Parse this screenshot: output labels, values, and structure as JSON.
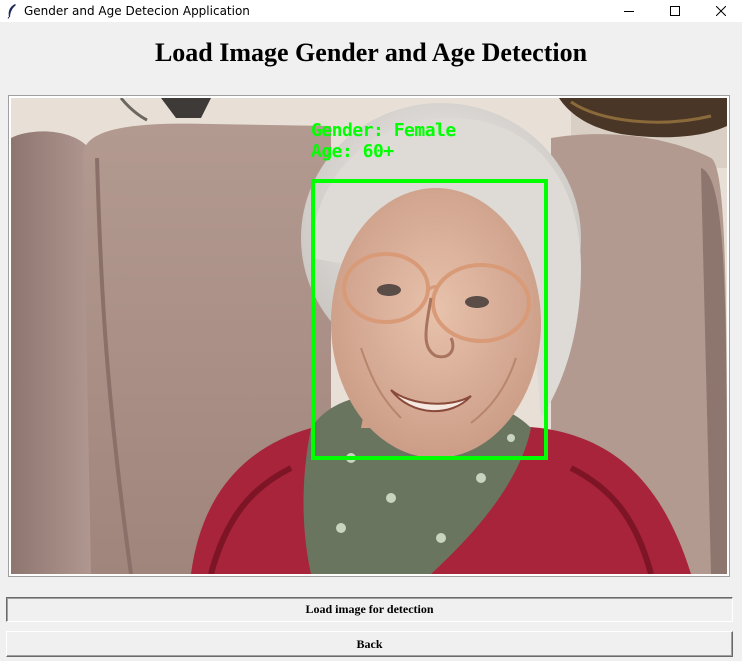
{
  "window": {
    "title": "Gender and Age Detecion Application",
    "icon": "feather-icon",
    "controls": [
      "minimize-icon",
      "maximize-icon",
      "close-icon"
    ]
  },
  "main": {
    "heading": "Load Image Gender and Age Detection",
    "image": {
      "description_icon": "photo",
      "overlay_color": "#00ff00",
      "gender_text": "Gender: Female",
      "age_text": "Age: 60+"
    }
  },
  "buttons": {
    "load_label": "Load image for detection",
    "back_label": "Back"
  }
}
